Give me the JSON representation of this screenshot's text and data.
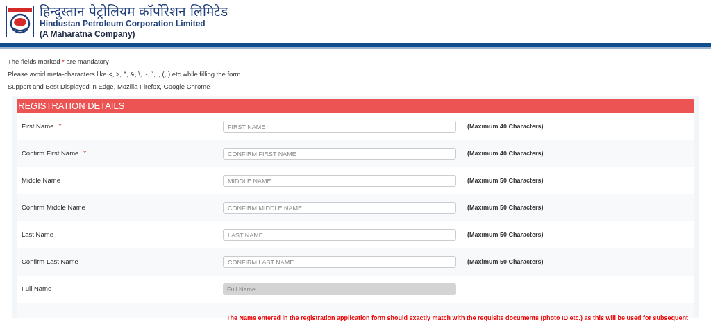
{
  "header": {
    "title_hindi": "हिन्दुस्तान पेट्रोलियम कॉर्पोरेशन लिमिटेड",
    "title": "Hindustan Petroleum Corporation Limited",
    "subtitle": "(A Maharatna Company)"
  },
  "notices": [
    {
      "text": "The fields marked ",
      "mark": "*",
      "rest": " are mandatory"
    },
    {
      "text": "Please avoid meta-characters like <, >, ^, &, \\, ~, `, ', (, ) etc while filling the form"
    },
    {
      "text": "Support and Best Displayed in Edge, Mozilla Firefox, Google Chrome"
    }
  ],
  "section": {
    "title": "REGISTRATION DETAILS"
  },
  "fields": [
    {
      "label": "First Name",
      "required": true,
      "placeholder": "FIRST NAME",
      "hint": "(Maximum 40 Characters)",
      "disabled": false
    },
    {
      "label": "Confirm First Name",
      "required": true,
      "placeholder": "CONFIRM FIRST NAME",
      "hint": "(Maximum 40 Characters)",
      "disabled": false
    },
    {
      "label": "Middle Name",
      "required": false,
      "placeholder": "MIDDLE NAME",
      "hint": "(Maximum 50 Characters)",
      "disabled": false
    },
    {
      "label": "Confirm Middle Name",
      "required": false,
      "placeholder": "CONFIRM MIDDLE NAME",
      "hint": "(Maximum 50 Characters)",
      "disabled": false
    },
    {
      "label": "Last Name",
      "required": false,
      "placeholder": "LAST NAME",
      "hint": "(Maximum 50 Characters)",
      "disabled": false
    },
    {
      "label": "Confirm Last Name",
      "required": false,
      "placeholder": "CONFIRM LAST NAME",
      "hint": "(Maximum 50 Characters)",
      "disabled": false
    },
    {
      "label": "Full Name",
      "required": false,
      "placeholder": "Full Name",
      "disabled": true
    }
  ],
  "note": "The Name entered in the registration application form should exactly match with the requisite documents (photo ID etc.) as this will be used for subsequent"
}
